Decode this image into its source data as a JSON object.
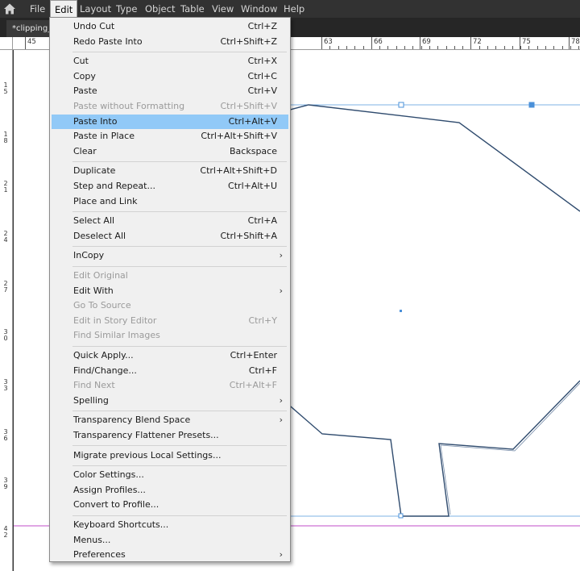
{
  "menubar": {
    "items": [
      "File",
      "Edit",
      "Layout",
      "Type",
      "Object",
      "Table",
      "View",
      "Window",
      "Help"
    ],
    "active": "Edit"
  },
  "document": {
    "tab_label": "*clipping_"
  },
  "ruler": {
    "horizontal_labels": [
      "45",
      "63",
      "66",
      "69",
      "72",
      "75",
      "78"
    ],
    "vertical_labels": [
      "15",
      "18",
      "21",
      "24",
      "27",
      "30",
      "33",
      "36",
      "39",
      "42"
    ]
  },
  "edit_menu": {
    "groups": [
      [
        {
          "label": "Undo Cut",
          "shortcut": "Ctrl+Z",
          "enabled": true
        },
        {
          "label": "Redo Paste Into",
          "shortcut": "Ctrl+Shift+Z",
          "enabled": true
        }
      ],
      [
        {
          "label": "Cut",
          "shortcut": "Ctrl+X",
          "enabled": true
        },
        {
          "label": "Copy",
          "shortcut": "Ctrl+C",
          "enabled": true
        },
        {
          "label": "Paste",
          "shortcut": "Ctrl+V",
          "enabled": true
        },
        {
          "label": "Paste without Formatting",
          "shortcut": "Ctrl+Shift+V",
          "enabled": false
        },
        {
          "label": "Paste Into",
          "shortcut": "Ctrl+Alt+V",
          "enabled": true,
          "highlighted": true
        },
        {
          "label": "Paste in Place",
          "shortcut": "Ctrl+Alt+Shift+V",
          "enabled": true
        },
        {
          "label": "Clear",
          "shortcut": "Backspace",
          "enabled": true
        }
      ],
      [
        {
          "label": "Duplicate",
          "shortcut": "Ctrl+Alt+Shift+D",
          "enabled": true
        },
        {
          "label": "Step and Repeat...",
          "shortcut": "Ctrl+Alt+U",
          "enabled": true
        },
        {
          "label": "Place and Link",
          "shortcut": "",
          "enabled": true
        }
      ],
      [
        {
          "label": "Select All",
          "shortcut": "Ctrl+A",
          "enabled": true
        },
        {
          "label": "Deselect All",
          "shortcut": "Ctrl+Shift+A",
          "enabled": true
        }
      ],
      [
        {
          "label": "InCopy",
          "shortcut": "",
          "enabled": true,
          "submenu": true
        }
      ],
      [
        {
          "label": "Edit Original",
          "shortcut": "",
          "enabled": false
        },
        {
          "label": "Edit With",
          "shortcut": "",
          "enabled": true,
          "submenu": true
        },
        {
          "label": "Go To Source",
          "shortcut": "",
          "enabled": false
        },
        {
          "label": "Edit in Story Editor",
          "shortcut": "Ctrl+Y",
          "enabled": false
        },
        {
          "label": "Find Similar Images",
          "shortcut": "",
          "enabled": false
        }
      ],
      [
        {
          "label": "Quick Apply...",
          "shortcut": "Ctrl+Enter",
          "enabled": true
        },
        {
          "label": "Find/Change...",
          "shortcut": "Ctrl+F",
          "enabled": true
        },
        {
          "label": "Find Next",
          "shortcut": "Ctrl+Alt+F",
          "enabled": false
        },
        {
          "label": "Spelling",
          "shortcut": "",
          "enabled": true,
          "submenu": true
        }
      ],
      [
        {
          "label": "Transparency Blend Space",
          "shortcut": "",
          "enabled": true,
          "submenu": true
        },
        {
          "label": "Transparency Flattener Presets...",
          "shortcut": "",
          "enabled": true
        }
      ],
      [
        {
          "label": "Migrate previous Local Settings...",
          "shortcut": "",
          "enabled": true
        }
      ],
      [
        {
          "label": "Color Settings...",
          "shortcut": "",
          "enabled": true
        },
        {
          "label": "Assign Profiles...",
          "shortcut": "",
          "enabled": true
        },
        {
          "label": "Convert to Profile...",
          "shortcut": "",
          "enabled": true
        }
      ],
      [
        {
          "label": "Keyboard Shortcuts...",
          "shortcut": "",
          "enabled": true
        },
        {
          "label": "Menus...",
          "shortcut": "",
          "enabled": true
        },
        {
          "label": "Preferences",
          "shortcut": "",
          "enabled": true,
          "submenu": true
        }
      ]
    ]
  },
  "colors": {
    "highlight": "#91c9f7",
    "path_stroke": "#2f4b6e",
    "selection": "#4a90d9",
    "guide": "#c04cc8"
  },
  "icons": {
    "home": "home-icon",
    "submenu": "chevron-right-icon"
  }
}
